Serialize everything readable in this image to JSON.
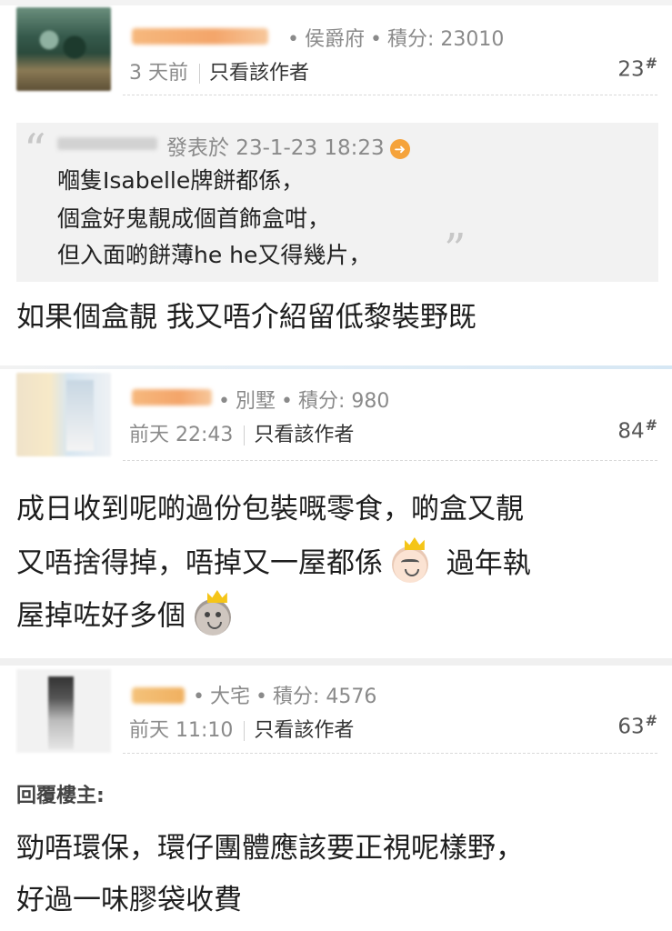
{
  "posts": [
    {
      "rank": "侯爵府",
      "score_label": "積分:",
      "score": "23010",
      "time": "3 天前",
      "only_author": "只看該作者",
      "floor": "23",
      "quote": {
        "posted_label": "發表於 23-1-23 18:23",
        "lines": [
          "嗰隻Isabelle牌餅都係，",
          "個盒好鬼靚成個首飾盒咁，",
          "但入面啲餅薄he he又得幾片，"
        ]
      },
      "body": [
        "如果個盒靚 我又唔介紹留低黎裝野既"
      ]
    },
    {
      "rank": "別墅",
      "score_label": "積分:",
      "score": "980",
      "time": "前天 22:43",
      "only_author": "只看該作者",
      "floor": "84",
      "body": [
        "成日收到呢啲過份包裝嘅零食，啲盒又靚",
        "又唔捨得掉，唔掉又一屋都係",
        "過年執",
        "屋掉咗好多個"
      ]
    },
    {
      "rank": "大宅",
      "score_label": "積分:",
      "score": "4576",
      "time": "前天 11:10",
      "only_author": "只看該作者",
      "floor": "63",
      "reply_label": "回覆樓主:",
      "body": [
        "勁唔環保，環仔團體應該要正視呢樣野，",
        "好過一味膠袋收費"
      ]
    }
  ],
  "floor_mark": "#",
  "icons": {
    "reply_arrow": "reply-arrow-icon",
    "emoji_cry": "crying-emoji-icon",
    "emoji_face": "smirk-emoji-icon"
  },
  "colors": {
    "meta_grey": "#8a8a8a",
    "quote_bg": "#f2f2f2",
    "arrow_orange": "#f5a33b"
  }
}
